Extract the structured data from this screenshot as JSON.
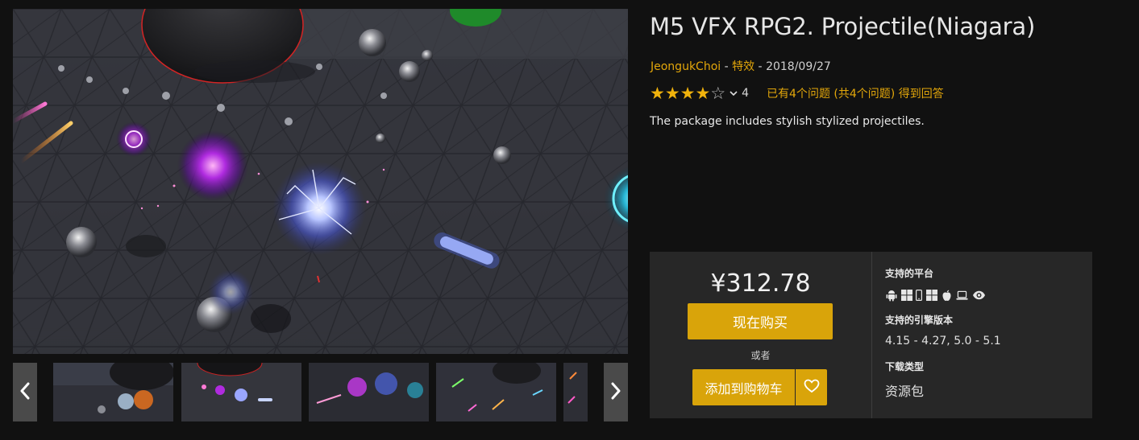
{
  "product": {
    "title": "M5 VFX RPG2. Projectile(Niagara)",
    "author": "JeongukChoi",
    "separator1": " - ",
    "category": "特效",
    "separator2": " - ",
    "date": "2018/09/27",
    "rating": {
      "stars_filled": 4,
      "stars_total": 5,
      "count": "4"
    },
    "questions_text": "已有4个问题 (共4个问题) 得到回答",
    "description": "The package includes stylish stylized projectiles."
  },
  "purchase": {
    "price": "¥312.78",
    "buy_now_label": "现在购买",
    "or_label": "或者",
    "add_to_cart_label": "添加到购物车"
  },
  "specs": {
    "platforms_label": "支持的平台",
    "platforms": [
      "android-icon",
      "windows-icon",
      "ios-phone-icon",
      "windows-store-icon",
      "apple-icon",
      "laptop-icon",
      "eye-icon"
    ],
    "engine_label": "支持的引擎版本",
    "engine_versions": "4.15 - 4.27, 5.0 - 5.1",
    "download_type_label": "下载类型",
    "download_type": "资源包"
  },
  "gallery": {
    "thumbnails_visible": 5
  },
  "colors": {
    "accent": "#d9a40a",
    "link": "#e2a60a",
    "star": "#f0b20c",
    "background": "#111111",
    "panel": "#272727"
  }
}
